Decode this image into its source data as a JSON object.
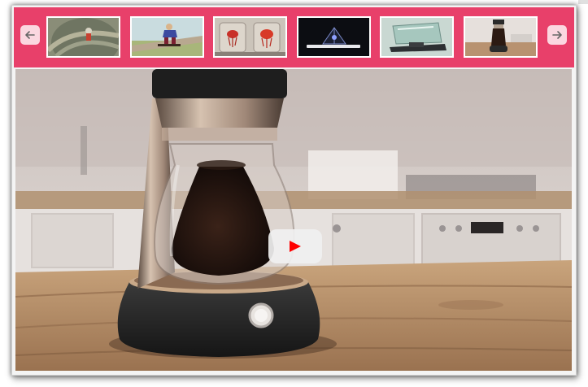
{
  "gallery": {
    "prev_icon": "arrow-left-icon",
    "next_icon": "arrow-right-icon",
    "accent_color": "#e8406a",
    "thumbnails": [
      {
        "name": "thumb-aerial-skateboarder"
      },
      {
        "name": "thumb-skateboarder-jump"
      },
      {
        "name": "thumb-jellyfish-jars"
      },
      {
        "name": "thumb-hologram-pyramid"
      },
      {
        "name": "thumb-car-hud-display"
      },
      {
        "name": "thumb-coffee-brewer",
        "selected": true
      }
    ]
  },
  "video": {
    "play_icon": "play-icon",
    "play_color": "#ff0000"
  }
}
